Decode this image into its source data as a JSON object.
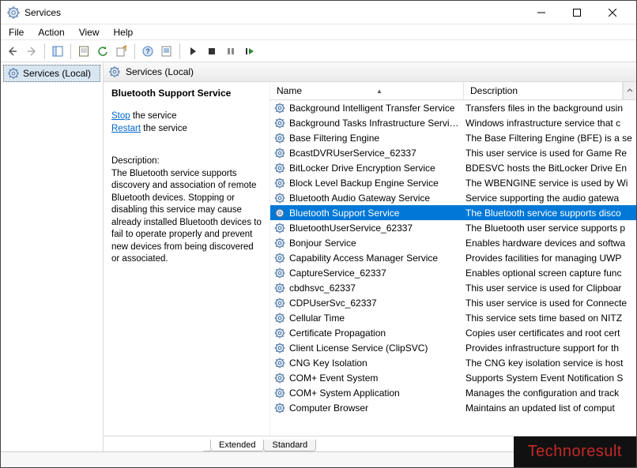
{
  "window": {
    "title": "Services"
  },
  "menu": {
    "file": "File",
    "action": "Action",
    "view": "View",
    "help": "Help"
  },
  "nav": {
    "label": "Services (Local)"
  },
  "panel": {
    "header_icon": "gear-icon",
    "header": "Services (Local)"
  },
  "details": {
    "title": "Bluetooth Support Service",
    "stop": "Stop",
    "stop_suffix": " the service",
    "restart": "Restart",
    "restart_suffix": " the service",
    "desc_label": "Description:",
    "desc_text": "The Bluetooth service supports discovery and association of remote Bluetooth devices.  Stopping or disabling this service may cause already installed Bluetooth devices to fail to operate properly and prevent new devices from being discovered or associated."
  },
  "columns": {
    "name": "Name",
    "desc": "Description"
  },
  "services": [
    {
      "name": "Background Intelligent Transfer Service",
      "desc": "Transfers files in the background usin",
      "selected": false
    },
    {
      "name": "Background Tasks Infrastructure Service",
      "desc": "Windows infrastructure service that c",
      "selected": false
    },
    {
      "name": "Base Filtering Engine",
      "desc": "The Base Filtering Engine (BFE) is a se",
      "selected": false
    },
    {
      "name": "BcastDVRUserService_62337",
      "desc": "This user service is used for Game Re",
      "selected": false
    },
    {
      "name": "BitLocker Drive Encryption Service",
      "desc": "BDESVC hosts the BitLocker Drive En",
      "selected": false
    },
    {
      "name": "Block Level Backup Engine Service",
      "desc": "The WBENGINE service is used by Wi",
      "selected": false
    },
    {
      "name": "Bluetooth Audio Gateway Service",
      "desc": "Service supporting the audio gatewa",
      "selected": false
    },
    {
      "name": "Bluetooth Support Service",
      "desc": "The Bluetooth service supports disco",
      "selected": true
    },
    {
      "name": "BluetoothUserService_62337",
      "desc": "The Bluetooth user service supports p",
      "selected": false
    },
    {
      "name": "Bonjour Service",
      "desc": "Enables hardware devices and softwa",
      "selected": false
    },
    {
      "name": "Capability Access Manager Service",
      "desc": "Provides facilities for managing UWP",
      "selected": false
    },
    {
      "name": "CaptureService_62337",
      "desc": "Enables optional screen capture func",
      "selected": false
    },
    {
      "name": "cbdhsvc_62337",
      "desc": "This user service is used for Clipboar",
      "selected": false
    },
    {
      "name": "CDPUserSvc_62337",
      "desc": "This user service is used for Connecte",
      "selected": false
    },
    {
      "name": "Cellular Time",
      "desc": "This service sets time based on NITZ",
      "selected": false
    },
    {
      "name": "Certificate Propagation",
      "desc": "Copies user certificates and root cert",
      "selected": false
    },
    {
      "name": "Client License Service (ClipSVC)",
      "desc": "Provides infrastructure support for th",
      "selected": false
    },
    {
      "name": "CNG Key Isolation",
      "desc": "The CNG key isolation service is host",
      "selected": false
    },
    {
      "name": "COM+ Event System",
      "desc": "Supports System Event Notification S",
      "selected": false
    },
    {
      "name": "COM+ System Application",
      "desc": "Manages the configuration and track",
      "selected": false
    },
    {
      "name": "Computer Browser",
      "desc": "Maintains an updated list of comput",
      "selected": false
    }
  ],
  "tabs": {
    "extended": "Extended",
    "standard": "Standard"
  },
  "watermark": "Technoresult"
}
